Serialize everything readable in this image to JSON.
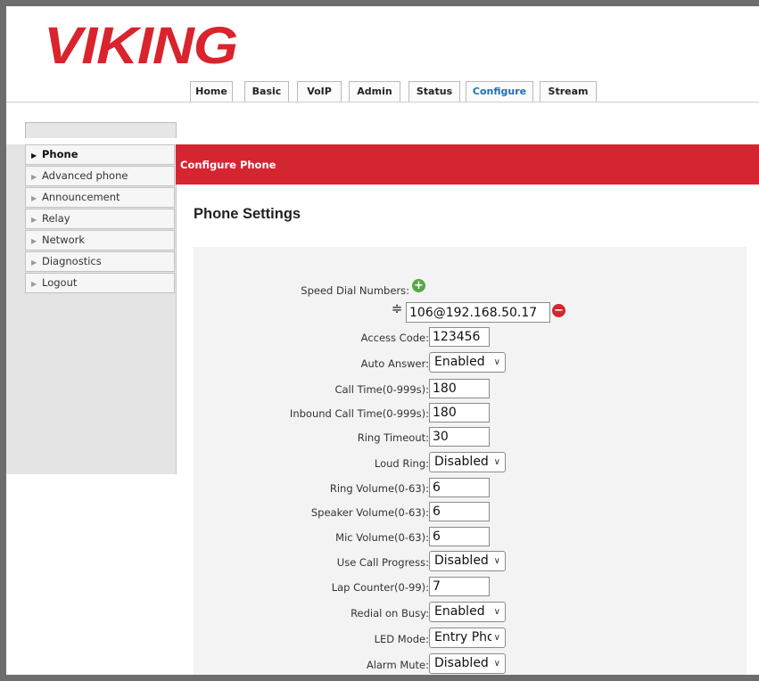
{
  "brand": {
    "logo_text": "VIKING"
  },
  "tabs": [
    {
      "label": "Home"
    },
    {
      "label": "Basic"
    },
    {
      "label": "VoIP"
    },
    {
      "label": "Admin"
    },
    {
      "label": "Status"
    },
    {
      "label": "Configure",
      "active": true
    },
    {
      "label": "Stream"
    }
  ],
  "sidebar": {
    "items": [
      {
        "label": "Phone",
        "active": true
      },
      {
        "label": "Advanced phone"
      },
      {
        "label": "Announcement"
      },
      {
        "label": "Relay"
      },
      {
        "label": "Network"
      },
      {
        "label": "Diagnostics"
      },
      {
        "label": "Logout"
      }
    ]
  },
  "header": {
    "bar_title": "Configure Phone"
  },
  "main": {
    "section_title": "Phone Settings",
    "speed_dial": {
      "label": "Speed Dial Numbers:",
      "value": "106@192.168.50.17"
    },
    "fields": [
      {
        "label": "Access Code:",
        "type": "input",
        "value": "123456"
      },
      {
        "label": "Auto Answer:",
        "type": "select",
        "value": "Enabled"
      },
      {
        "label": "Call Time(0-999s):",
        "type": "input",
        "value": "180"
      },
      {
        "label": "Inbound Call Time(0-999s):",
        "type": "input",
        "value": "180"
      },
      {
        "label": "Ring Timeout:",
        "type": "input",
        "value": "30"
      },
      {
        "label": "Loud Ring:",
        "type": "select",
        "value": "Disabled"
      },
      {
        "label": "Ring Volume(0-63):",
        "type": "input",
        "value": "6"
      },
      {
        "label": "Speaker Volume(0-63):",
        "type": "input",
        "value": "6"
      },
      {
        "label": "Mic Volume(0-63):",
        "type": "input",
        "value": "6"
      },
      {
        "label": "Use Call Progress:",
        "type": "select",
        "value": "Disabled"
      },
      {
        "label": "Lap Counter(0-99):",
        "type": "input",
        "value": "7"
      },
      {
        "label": "Redial on Busy:",
        "type": "select",
        "value": "Enabled"
      },
      {
        "label": "LED Mode:",
        "type": "select",
        "value": "Entry Phone"
      },
      {
        "label": "Alarm Mute:",
        "type": "select",
        "value": "Disabled"
      }
    ]
  },
  "colors": {
    "brand_red": "#d9232d",
    "header_bar": "#d42531",
    "active_tab": "#1f6fb2",
    "add_green": "#56a845"
  },
  "icons": {
    "add": "plus-circle-icon",
    "remove": "minus-circle-icon",
    "drag": "drag-handle-icon",
    "nav_arrow": "triangle-right-icon",
    "dropdown": "chevron-down-icon"
  }
}
